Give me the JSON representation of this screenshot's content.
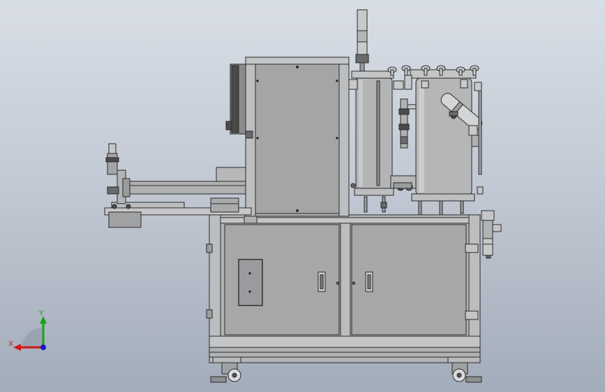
{
  "viewport": {
    "background_top": "#d9dee6",
    "background_bottom": "#a3acba"
  },
  "triad": {
    "x_label": "X",
    "y_label": "Y",
    "x_color": "#d01818",
    "y_color": "#1aa01a",
    "z_color": "#1818c8"
  },
  "model": {
    "body_color": "#a9aaac",
    "edge_color": "#2a2a2a",
    "frame_color": "#bfc0c2",
    "dark_color": "#4a4a4a"
  }
}
